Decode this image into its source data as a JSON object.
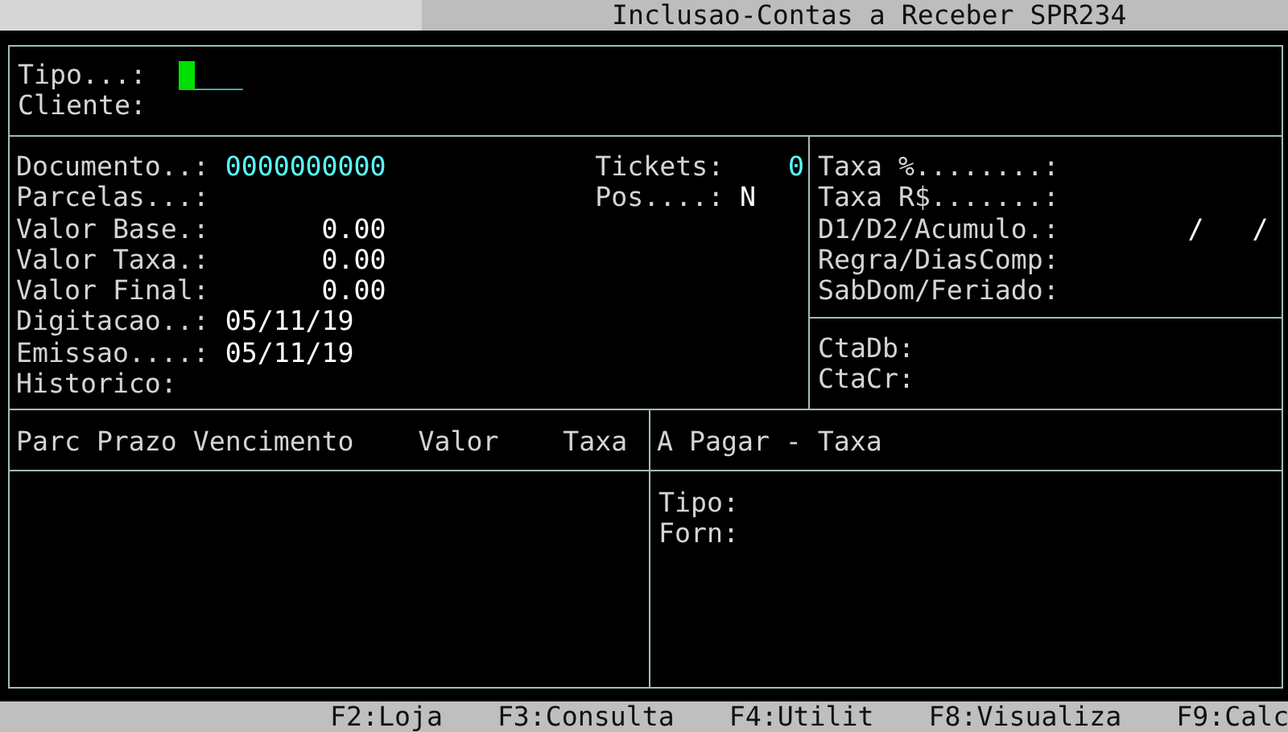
{
  "window": {
    "title": "Inclusao-Contas a Receber SPR234"
  },
  "header_fields": [
    {
      "label": "Tipo...:",
      "value": "___",
      "focused": true
    },
    {
      "label": "Cliente:",
      "focused": false
    }
  ],
  "main_fields": [
    {
      "label": "Documento..:",
      "value": "0000000000",
      "color": "#55ffff",
      "kind": "amount"
    },
    {
      "label": "Parcelas...:"
    },
    {
      "label": "Valor Base.:",
      "value": "0.00",
      "color": "#ffffff",
      "kind": "amount"
    },
    {
      "label": "Valor Taxa.:",
      "value": "0.00",
      "color": "#ffffff",
      "kind": "amount"
    },
    {
      "label": "Valor Final:",
      "value": "0.00",
      "color": "#ffffff",
      "kind": "amount"
    },
    {
      "label": "Digitacao..:",
      "value": "05/11/19",
      "color": "#ffffff",
      "kind": "text"
    },
    {
      "label": "Emissao....:",
      "value": "05/11/19",
      "color": "#ffffff",
      "kind": "text"
    },
    {
      "label": "Historico:"
    }
  ],
  "side_fields": [
    {
      "label": "Tickets:",
      "value": "0",
      "color": "#55ffff",
      "kind": "amount"
    },
    {
      "label": "Pos....:",
      "value": "N",
      "color": "#ffffff",
      "kind": "text"
    }
  ],
  "rate_fields": [
    {
      "label": "Taxa %........:"
    },
    {
      "label": "Taxa R$.......:"
    },
    {
      "label": "D1/D2/Acumulo.:",
      "value": "/   /",
      "color": "#ffffff"
    },
    {
      "label": "Regra/DiasComp:"
    },
    {
      "label": "SabDom/Feriado:"
    }
  ],
  "account_fields": [
    {
      "label": "CtaDb:"
    },
    {
      "label": "CtaCr:"
    }
  ],
  "installments": {
    "columns": [
      "Parc",
      "Prazo",
      "Vencimento",
      "Valor",
      "Taxa"
    ]
  },
  "payable": {
    "title": "A Pagar - Taxa",
    "fields": [
      {
        "label": "Tipo:"
      },
      {
        "label": "Forn:"
      }
    ]
  },
  "function_keys": [
    "F2:Loja",
    "F3:Consulta",
    "F4:Utilit",
    "F8:Visualiza",
    "F9:Calc"
  ]
}
